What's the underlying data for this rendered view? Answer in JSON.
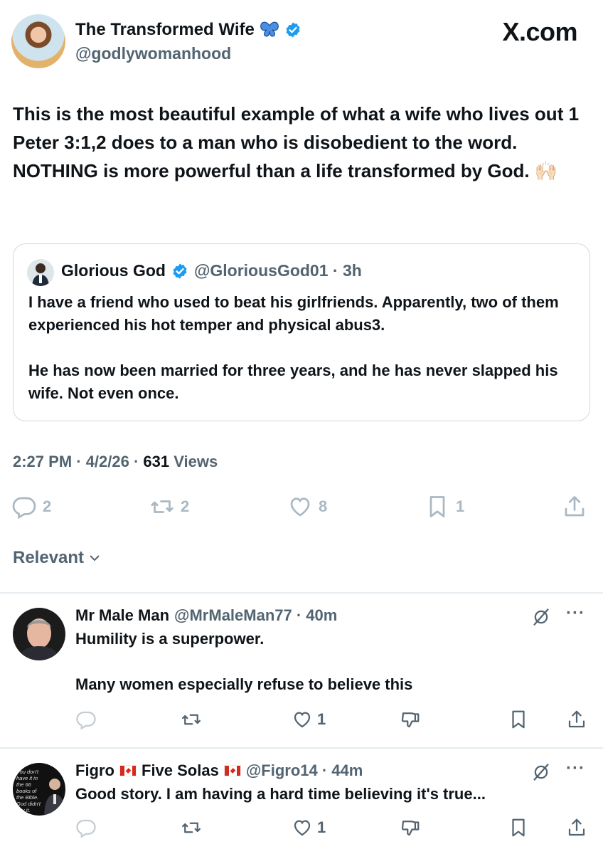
{
  "header": {
    "author_name": "The Transformed Wife",
    "author_handle": "@godlywomanhood",
    "watermark": "X.com"
  },
  "tweet": {
    "text": "This is the most beautiful example of what a wife who lives out 1 Peter 3:1,2 does to a man who is disobedient to the word. NOTHING is more powerful than a life transformed by God. 🙌🏻",
    "time": "2:27 PM · 4/2/26 · ",
    "views_count": "631",
    "views_label": " Views"
  },
  "quote": {
    "name": "Glorious God",
    "meta": "@GloriousGod01 · 3h",
    "text_p1": "I have a friend who used to beat his girlfriends. Apparently, two of them experienced his hot temper and physical abus3.",
    "text_p2": "He has now been married for three years, and he has never slapped his wife. Not even once."
  },
  "actions": {
    "replies": "2",
    "reposts": "2",
    "likes": "8",
    "bookmarks": "1"
  },
  "sort": {
    "label": "Relevant"
  },
  "replies": [
    {
      "name": "Mr Male Man",
      "meta": "@MrMaleMan77 · 40m",
      "text_p1": "Humility is a superpower.",
      "text_p2": "Many women especially refuse to believe this",
      "likes": "1"
    },
    {
      "name_a": "Figro",
      "name_b": "Five Solas",
      "meta": "@Figro14 · 44m",
      "text_p1": "Good story. I am having a hard time believing it's true...",
      "likes": "1",
      "avatar_text": "You don't have it in the 66 books of the Bible. God didn't say it."
    }
  ],
  "colors": {
    "text": "#0f1419",
    "muted": "#536471",
    "verified": "#1d9bf0",
    "border": "#cfd9de"
  }
}
